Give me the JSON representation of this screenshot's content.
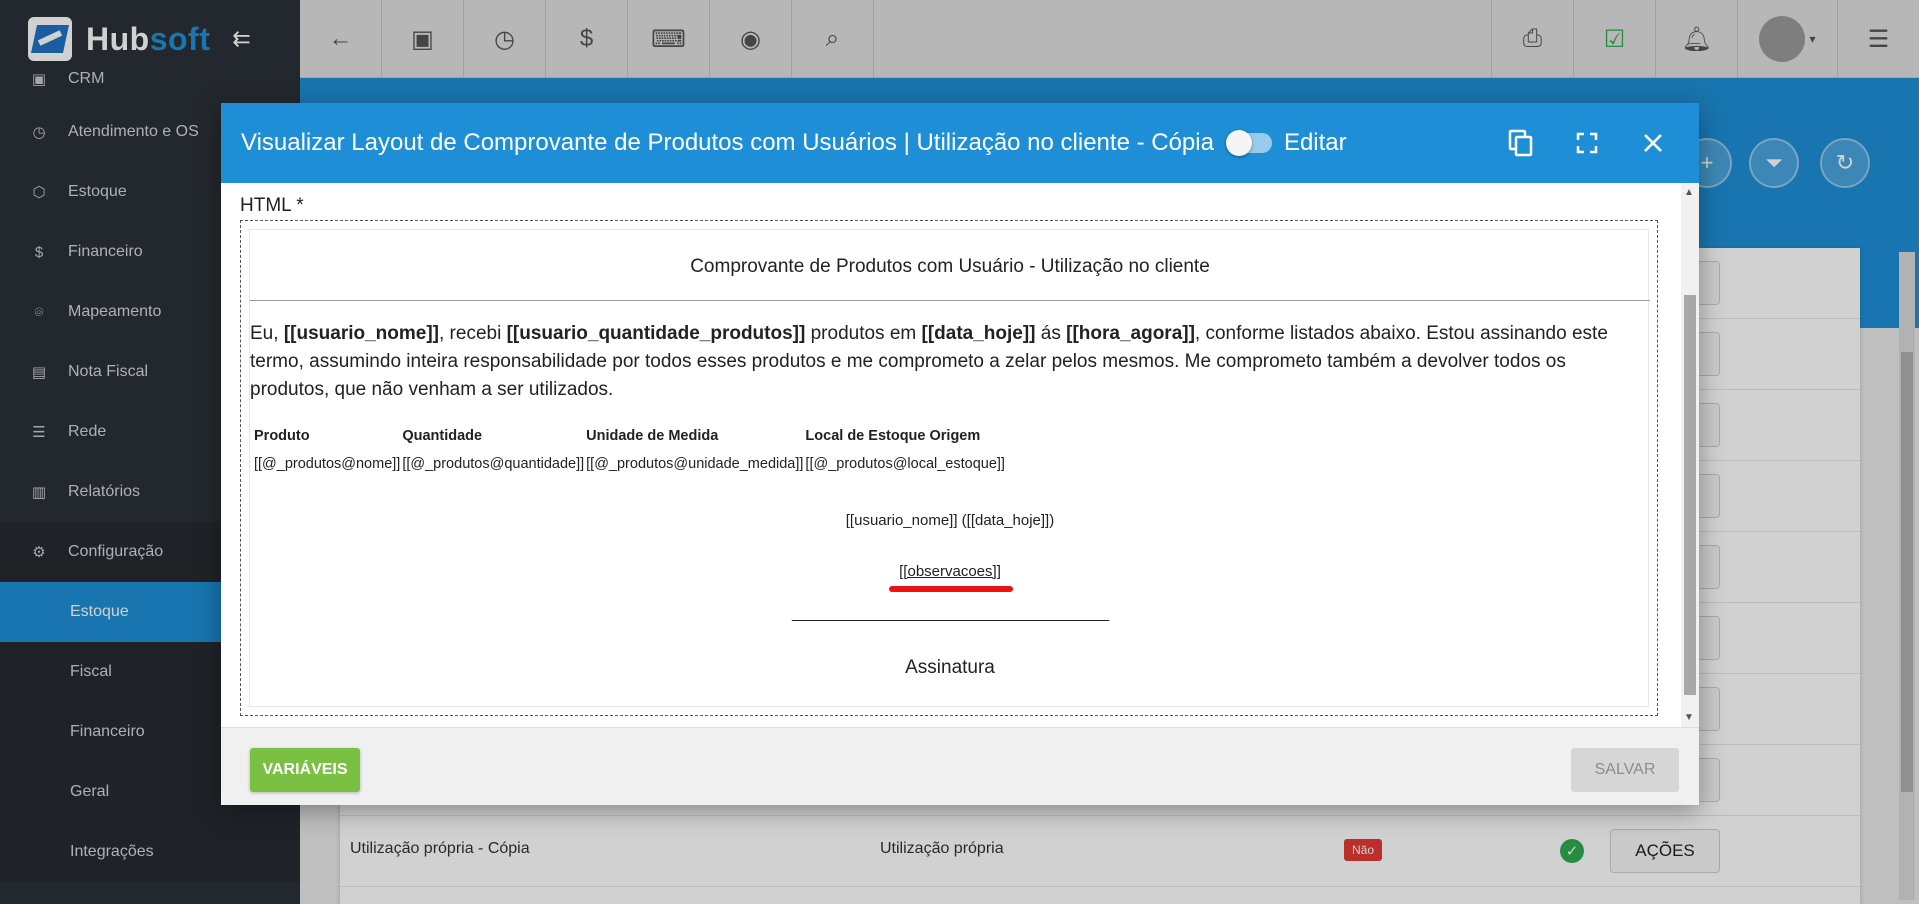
{
  "brand": {
    "hub": "Hub",
    "soft": "soft"
  },
  "sidebar": {
    "items": [
      {
        "label": "CRM",
        "icon": "crm-icon"
      },
      {
        "label": "Atendimento e OS",
        "icon": "calendar-icon"
      },
      {
        "label": "Estoque",
        "icon": "box-icon"
      },
      {
        "label": "Financeiro",
        "icon": "money-icon"
      },
      {
        "label": "Mapeamento",
        "icon": "map-pin-icon"
      },
      {
        "label": "Nota Fiscal",
        "icon": "document-icon"
      },
      {
        "label": "Rede",
        "icon": "server-icon"
      },
      {
        "label": "Relatórios",
        "icon": "report-icon"
      },
      {
        "label": "Configuração",
        "icon": "gear-icon"
      },
      {
        "label": "Estoque"
      },
      {
        "label": "Fiscal"
      },
      {
        "label": "Financeiro"
      },
      {
        "label": "Geral"
      },
      {
        "label": "Integrações"
      }
    ]
  },
  "background_table": {
    "action_label": "AÇÕES",
    "last_row": {
      "name": "Utilização própria - Cópia",
      "type": "Utilização própria",
      "badge": "Não"
    }
  },
  "modal": {
    "title": "Visualizar Layout de Comprovante de Produtos com Usuários | Utilização no cliente - Cópia",
    "edit_label": "Editar",
    "field_label": "HTML *",
    "doc": {
      "title": "Comprovante de Produtos com Usuário - Utilização no cliente",
      "para": {
        "p1": "Eu, ",
        "v1": "[[usuario_nome]]",
        "p2": ", recebi ",
        "v2": "[[usuario_quantidade_produtos]]",
        "p3": " produtos em ",
        "v3": "[[data_hoje]]",
        "p4": " ás ",
        "v4": "[[hora_agora]]",
        "p5": ", conforme listados abaixo. Estou assinando este termo, assumindo inteira responsabilidade por todos esses produtos e me comprometo a zelar pelos mesmos. Me comprometo também a devolver todos os produtos, que não venham a ser utilizados."
      },
      "table": {
        "headers": [
          "Produto",
          "Quantidade",
          "Unidade de Medida",
          "Local de Estoque Origem"
        ],
        "cells": [
          "[[@_produtos@nome]]",
          "[[@_produtos@quantidade]]",
          "[[@_produtos@unidade_medida]]",
          "[[@_produtos@local_estoque]]"
        ]
      },
      "sig_name": "[[usuario_nome]] ([[data_hoje]])",
      "observacoes": "[[observacoes]]",
      "sig_line": "________________________________________",
      "sig_label": "Assinatura"
    },
    "buttons": {
      "variables": "VARIÁVEIS",
      "save": "SALVAR"
    }
  },
  "colors": {
    "primary": "#1e8fd6",
    "sidebar": "#2b3139",
    "success": "#7ac143",
    "danger": "#e53935",
    "highlight": "#ee1111"
  }
}
